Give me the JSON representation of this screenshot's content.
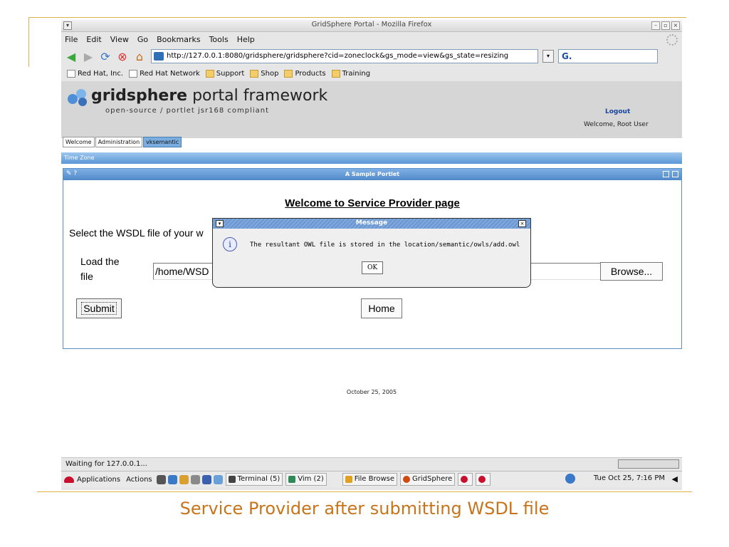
{
  "browser": {
    "title": "GridSphere Portal - Mozilla Firefox",
    "menu": [
      "File",
      "Edit",
      "View",
      "Go",
      "Bookmarks",
      "Tools",
      "Help"
    ],
    "url": "http://127.0.0.1:8080/gridsphere/gridsphere?cid=zoneclock&gs_mode=view&gs_state=resizing",
    "search_value": "G.",
    "bookmarks": [
      {
        "label": "Red Hat, Inc.",
        "icon": "page-icon"
      },
      {
        "label": "Red Hat Network",
        "icon": "page-icon"
      },
      {
        "label": "Support",
        "icon": "folder-icon"
      },
      {
        "label": "Shop",
        "icon": "folder-icon"
      },
      {
        "label": "Products",
        "icon": "folder-icon"
      },
      {
        "label": "Training",
        "icon": "folder-icon"
      }
    ],
    "status": "Waiting for 127.0.0.1..."
  },
  "portal": {
    "brand_bold": "gridsphere",
    "brand_rest": " portal framework",
    "subtitle": "open-source / portlet jsr168 compliant",
    "logout": "Logout",
    "welcome_user": "Welcome, Root User",
    "tabs": [
      "Welcome",
      "Administration",
      "vksemantic"
    ],
    "active_tab": "vksemantic",
    "subnav": "Time Zone",
    "portlet_controls": "✎ ?",
    "portlet_title": "A Sample Portlet",
    "heading": "Welcome to Service Provider page",
    "select_text": "Select the WSDL file of your w",
    "load_label": "Load the file",
    "file_value": "/home/WSD",
    "browse": "Browse...",
    "submit": "Submit",
    "home": "Home",
    "date": "October 25, 2005"
  },
  "dialog": {
    "title": "Message",
    "message": "The resultant OWL file is stored in the location/semantic/owls/add.owl",
    "ok": "OK",
    "icon_glyph": "i"
  },
  "taskbar": {
    "applications": "Applications",
    "actions": "Actions",
    "tasks": [
      {
        "label": "Terminal (5)",
        "color": "#444444"
      },
      {
        "label": "Vim (2)",
        "color": "#2e8b57"
      },
      {
        "label": "File Browse",
        "color": "#e0a020"
      },
      {
        "label": "GridSphere",
        "color": "#d04a10"
      }
    ],
    "clock": "Tue Oct 25,  7:16 PM"
  },
  "caption": "Service Provider after submitting WSDL file",
  "colors": {
    "accent": "#5b97d6",
    "caption": "#c8741a",
    "slide_line": "#d9b24a"
  }
}
